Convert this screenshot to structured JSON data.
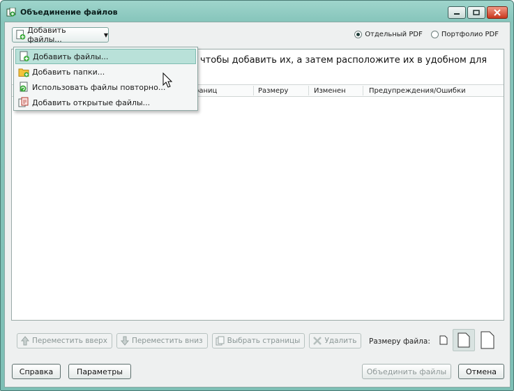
{
  "window": {
    "title": "Объединение файлов",
    "icon": "combine-files-icon"
  },
  "toolbar": {
    "add_files_label": "Добавить файлы...",
    "dropdown_arrow": "▼"
  },
  "output_mode": {
    "single_pdf": "Отдельный PDF",
    "portfolio_pdf": "Портфолио PDF",
    "selected": "single_pdf"
  },
  "menu": {
    "items": [
      {
        "label": "Добавить файлы...",
        "icon": "add-file-icon",
        "active": true
      },
      {
        "label": "Добавить папки...",
        "icon": "folder-icon",
        "active": false
      },
      {
        "label": "Использовать файлы повторно...",
        "icon": "reuse-files-icon",
        "active": false
      },
      {
        "label": "Добавить открытые файлы...",
        "icon": "open-files-icon",
        "active": false
      }
    ]
  },
  "list": {
    "hint_line1": "чтобы добавить их, а затем расположите их в удобном для",
    "columns": [
      "раниц",
      "Размеру",
      "Изменен",
      "Предупреждения/Ошибки"
    ]
  },
  "bottom_tools": {
    "move_up": "Переместить вверх",
    "move_down": "Переместить вниз",
    "choose_pages": "Выбрать страницы",
    "delete": "Удалить"
  },
  "file_size": {
    "label": "Размеру файла:",
    "options": [
      "small",
      "medium",
      "large"
    ],
    "selected": "medium"
  },
  "footer": {
    "help": "Справка",
    "options": "Параметры",
    "combine": "Объединить файлы",
    "cancel": "Отмена"
  }
}
